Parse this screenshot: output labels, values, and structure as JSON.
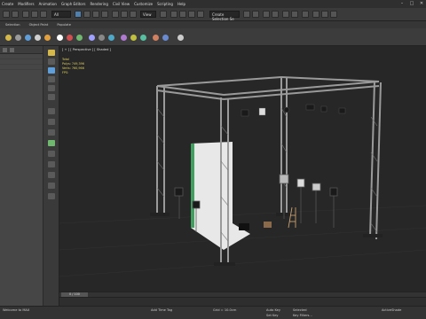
{
  "menu": {
    "items": [
      "Create",
      "Modifiers",
      "Animation",
      "Graph Editors",
      "Rendering",
      "Civil View",
      "Customize",
      "Scripting",
      "Help"
    ]
  },
  "toolbar": {
    "selection_filter": "All",
    "view_dropdown": "View",
    "selection_set": "Create Selection Se"
  },
  "ribbon": {
    "tabs": [
      "Selection",
      "Object Paint",
      "Populate"
    ]
  },
  "viewport": {
    "label": "[ + ] [ Perspective ] [ Shaded ]",
    "stats": {
      "total_label": "Total",
      "polys": "Polys:   749,396",
      "verts": "Verts:   760,966",
      "fps": "FPS:"
    }
  },
  "timeline": {
    "frame_label": "0 / 100"
  },
  "status": {
    "maxscript": "Welcome to MAX",
    "grid": "Grid = 10.0cm",
    "addtime": "Add Time Tag",
    "autokey": "Auto Key",
    "selected": "Selected",
    "setkey": "Set Key",
    "keyfilters": "Key Filters...",
    "activity": "ActiveShade"
  },
  "colors": {
    "viewport_bg": "#272727",
    "truss": "#9a9a9a",
    "backdrop": "#e8e8e8",
    "accent_blue": "#4f7fae"
  }
}
